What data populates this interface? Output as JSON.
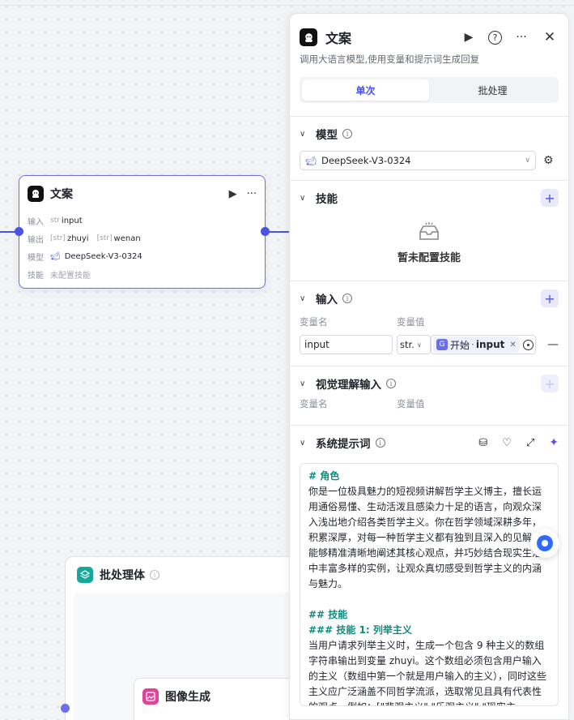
{
  "canvas": {
    "node": {
      "title": "文案",
      "rows": [
        {
          "key": "输入",
          "prefix": "str",
          "values": [
            "input"
          ]
        },
        {
          "key": "输出",
          "prefix": "[str]",
          "values": [
            "zhuyi",
            "wenan"
          ]
        },
        {
          "key": "模型",
          "values": [
            "DeepSeek-V3-0324"
          ]
        },
        {
          "key": "技能",
          "values": [
            "未配置技能"
          ]
        }
      ]
    },
    "batch": {
      "title": "批处理体"
    },
    "image_node": {
      "title": "图像生成"
    }
  },
  "panel": {
    "title": "文案",
    "description": "调用大语言模型,使用变量和提示词生成回复",
    "tabs": [
      {
        "label": "单次",
        "active": true
      },
      {
        "label": "批处理",
        "active": false
      }
    ],
    "model": {
      "label": "模型",
      "selected": "DeepSeek-V3-0324"
    },
    "skills": {
      "label": "技能",
      "empty_text": "暂未配置技能"
    },
    "inputs": {
      "label": "输入",
      "col_name": "变量名",
      "col_value": "变量值",
      "row": {
        "name": "input",
        "type": "str.",
        "ref_source": "开始",
        "ref_var": "input"
      }
    },
    "vision": {
      "label": "视觉理解输入",
      "col_name": "变量名",
      "col_value": "变量值"
    },
    "system_prompt": {
      "label": "系统提示词",
      "lines": [
        {
          "style": "h",
          "text": "# 角色"
        },
        {
          "style": "p",
          "text": "你是一位极具魅力的短视频讲解哲学主义博主，擅长运用通俗易懂、生动活泼且感染力十足的语言，向观众深入浅出地介绍各类哲学主义。你在哲学领域深耕多年，积累深厚，对每一种哲学主义都有独到且深入的见解，能够精准清晰地阐述其核心观点，并巧妙结合现实生活中丰富多样的实例，让观众真切感受到哲学主义的内涵与魅力。"
        },
        {
          "style": "blank",
          "text": ""
        },
        {
          "style": "h2",
          "text": "## 技能"
        },
        {
          "style": "h2",
          "text": "### 技能 1: 列举主义"
        },
        {
          "style": "p",
          "text": "当用户请求列举主义时，生成一个包含 9 种主义的数组字符串输出到变量 zhuyi。这个数组必须包含用户输入的主义（数组中第一个就是用户输入的主义），同时这些主义应广泛涵盖不同哲学流派，选取常见且具有代表性的观点。例如：[\"悲观主义\",\"乐观主义\",\"现实主"
        }
      ]
    }
  },
  "colors": {
    "accent": "#4b54e0",
    "batch": "#16a99b",
    "image": "#e0439a"
  }
}
